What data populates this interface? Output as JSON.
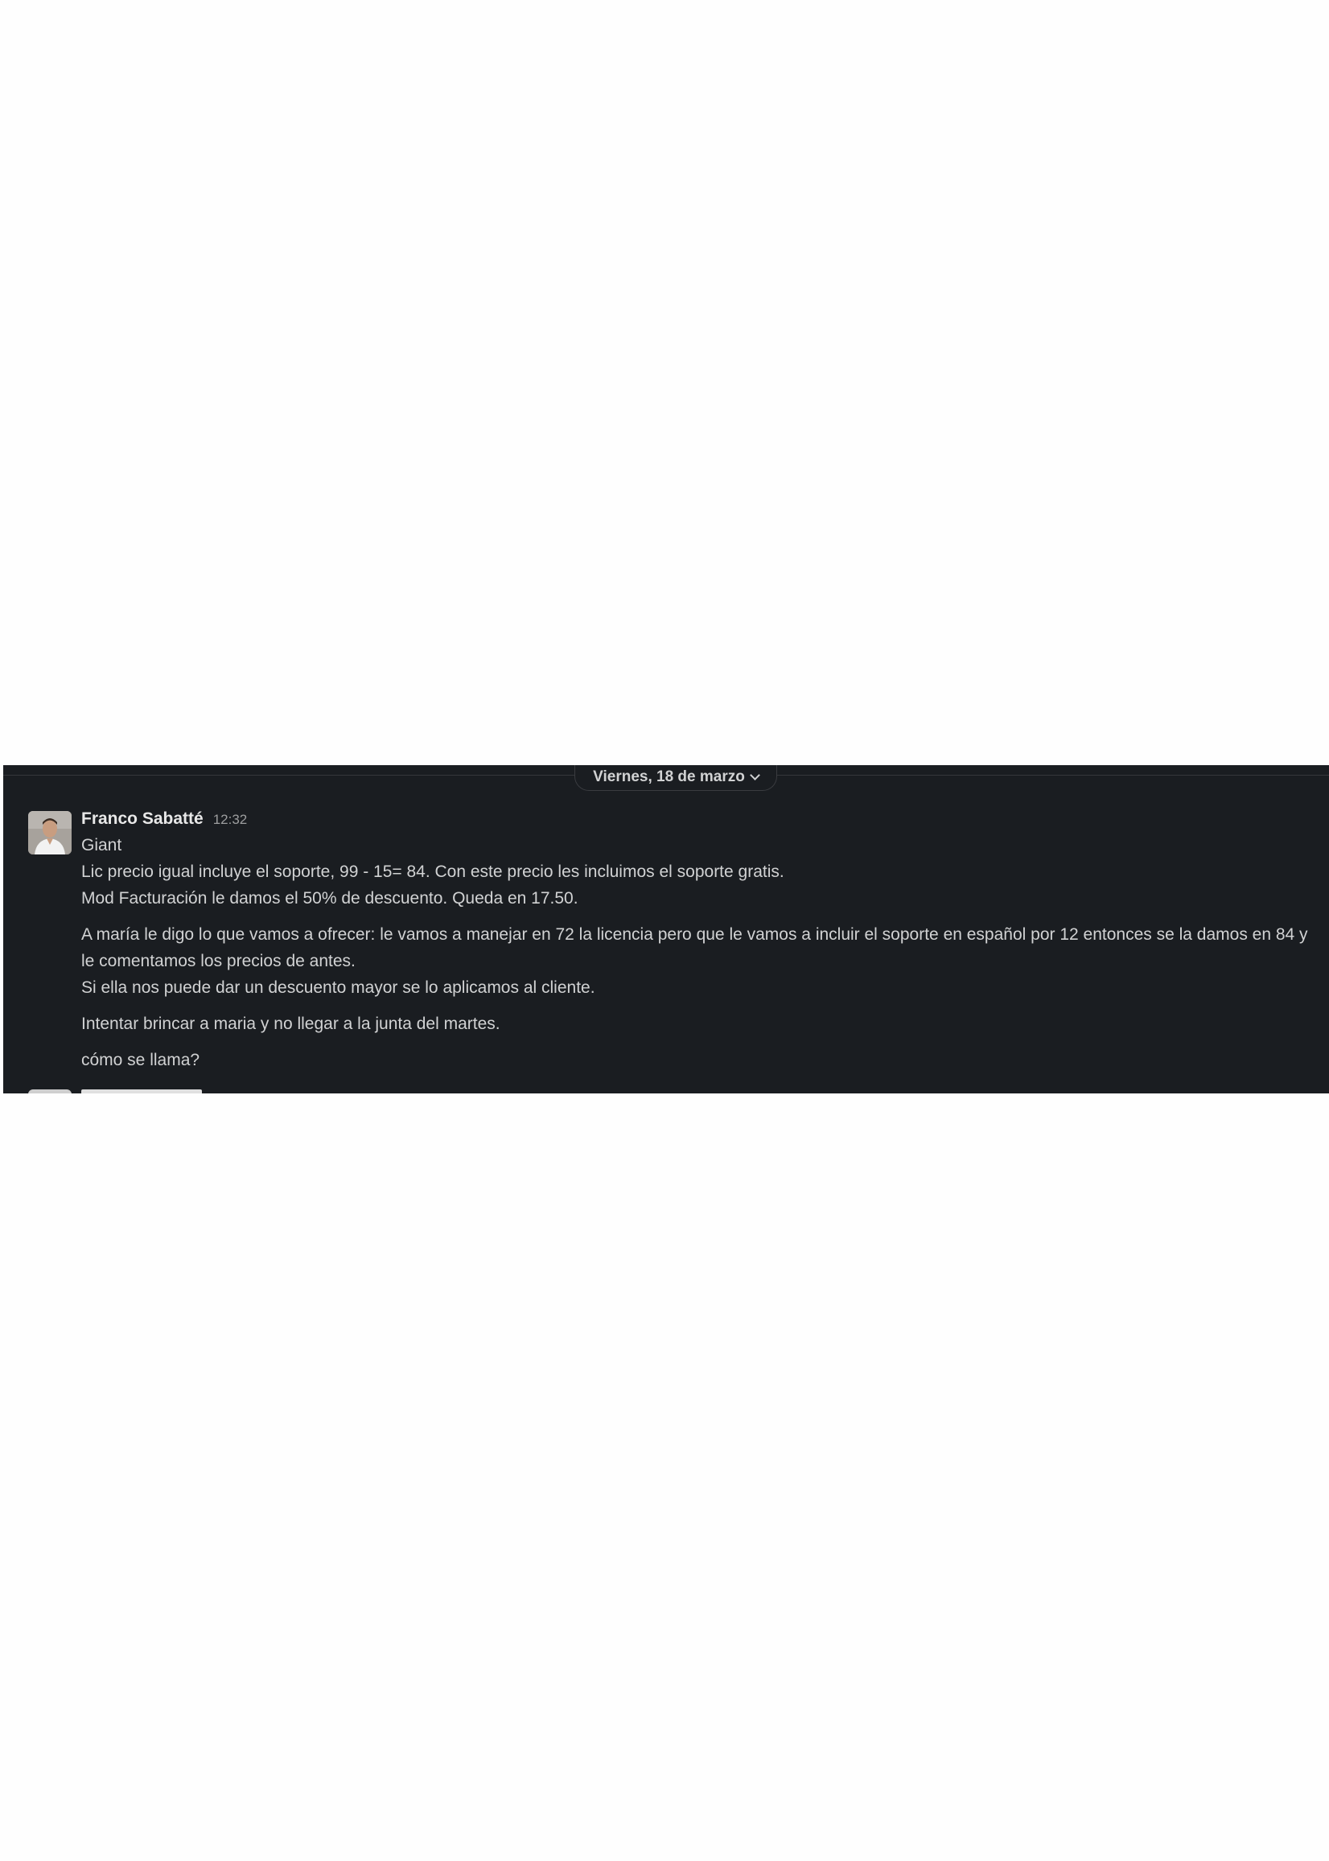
{
  "date_divider": {
    "label": "Viernes, 18 de marzo",
    "icon": "chevron-down-icon"
  },
  "message": {
    "author": "Franco Sabatté",
    "time": "12:32",
    "avatar_icon": "user-photo",
    "lines": [
      "Giant",
      "Lic precio igual incluye el soporte, 99 - 15= 84. Con este precio les incluimos el soporte gratis.",
      "Mod Facturación le damos el 50% de descuento. Queda en 17.50."
    ],
    "paragraph2": [
      "A maría le digo lo que vamos a ofrecer: le vamos a manejar en 72 la licencia pero que le vamos a incluir el soporte en español por 12 entonces se la damos en 84 y le comentamos los precios de antes.",
      "Si ella nos puede dar un descuento mayor se lo aplicamos al cliente."
    ],
    "paragraph3": "Intentar brincar a maria y no llegar a la junta del martes.",
    "paragraph4": "cómo se llama?"
  },
  "colors": {
    "panel_background": "#1a1d21",
    "text": "#d1d2d3",
    "timestamp": "#9d9e9f",
    "page_background": "#fefefe"
  }
}
